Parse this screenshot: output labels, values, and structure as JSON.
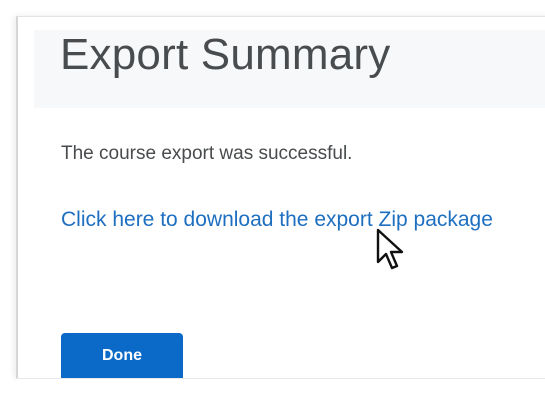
{
  "dialog": {
    "title": "Export Summary",
    "message": "The course export was successful.",
    "download_link": "Click here to download the export Zip package",
    "done_label": "Done"
  },
  "icons": {
    "cursor": "mouse-pointer-arrow-icon"
  },
  "colors": {
    "title_text": "#494c4e",
    "link": "#1e6fc0",
    "primary_button": "#0b6ac7",
    "header_band": "#f7f8fa"
  }
}
